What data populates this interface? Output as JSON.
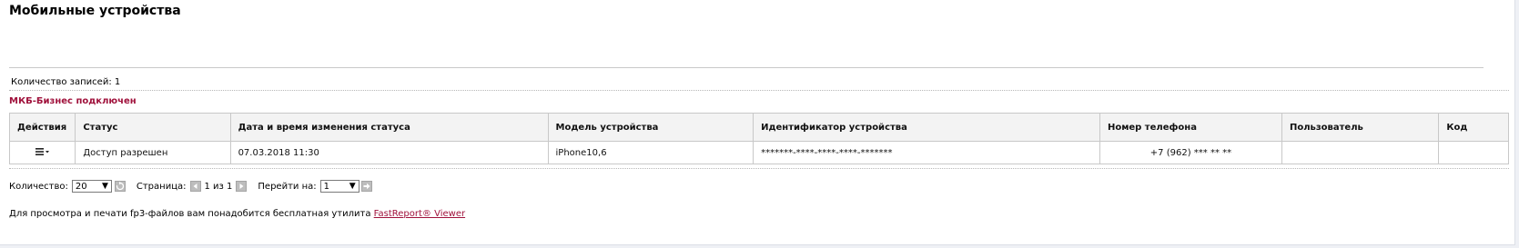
{
  "page": {
    "title": "Мобильные устройства"
  },
  "records": {
    "label": "Количество записей: 1"
  },
  "section": {
    "title": "МКБ-Бизнес подключен",
    "accent_color": "#a0123c"
  },
  "table": {
    "columns": [
      "Действия",
      "Статус",
      "Дата и время изменения статуса",
      "Модель устройства",
      "Идентификатор устройства",
      "Номер телефона",
      "Пользователь",
      "Код"
    ],
    "rows": [
      {
        "actions_icon": "menu-dropdown-icon",
        "status": "Доступ разрешен",
        "changed_at": "07.03.2018 11:30",
        "model": "iPhone10,6",
        "device_id": "*******-****-****-****-*******",
        "phone": "+7 (962) *** ** **",
        "user": "",
        "code": ""
      }
    ]
  },
  "pager": {
    "count_label": "Количество:",
    "count_value": "20",
    "page_label": "Страница:",
    "page_info": "1 из 1",
    "goto_label": "Перейти на:",
    "goto_value": "1"
  },
  "info": {
    "text": "Для просмотра и печати fp3-файлов вам понадобится бесплатная утилита",
    "link": "FastReport® Viewer"
  }
}
